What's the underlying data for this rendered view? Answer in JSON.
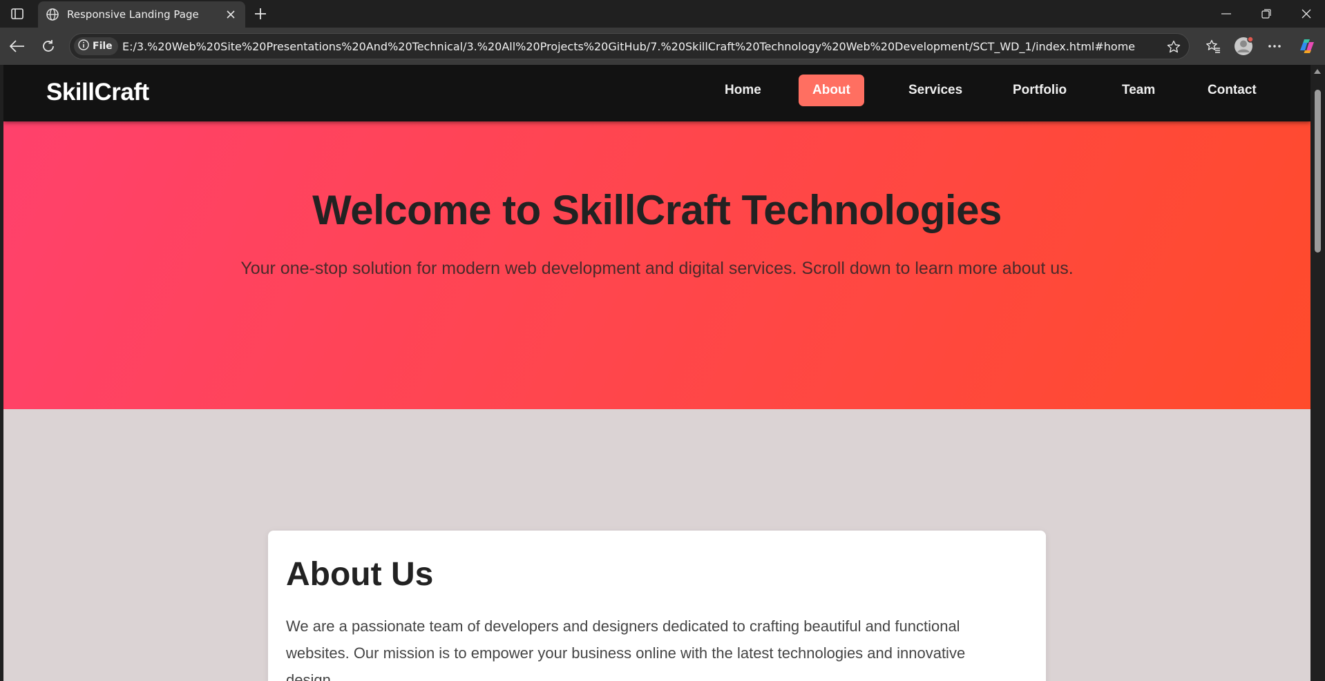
{
  "browser": {
    "tab_title": "Responsive Landing Page",
    "address_chip": "File",
    "url": "E:/3.%20Web%20Site%20Presentations%20And%20Technical/3.%20All%20Projects%20GitHub/7.%20SkillCraft%20Technology%20Web%20Development/SCT_WD_1/index.html#home"
  },
  "site": {
    "logo": "SkillCraft",
    "nav": [
      "Home",
      "About",
      "Services",
      "Portfolio",
      "Team",
      "Contact"
    ],
    "active_nav": "About",
    "accent_color": "#ff6f61"
  },
  "hero": {
    "title": "Welcome to SkillCraft Technologies",
    "subtitle": "Your one-stop solution for modern web development and digital services. Scroll down to learn more about us."
  },
  "about": {
    "heading": "About Us",
    "text": "We are a passionate team of developers and designers dedicated to crafting beautiful and functional websites. Our mission is to empower your business online with the latest technologies and innovative design."
  },
  "icons": [
    "sidebar-icon",
    "globe-icon",
    "close-icon",
    "plus-icon",
    "minimize-icon",
    "restore-icon",
    "window-close-icon",
    "back-icon",
    "refresh-icon",
    "info-icon",
    "star-icon",
    "favorites-icon",
    "profile-icon",
    "more-icon",
    "copilot-icon"
  ]
}
